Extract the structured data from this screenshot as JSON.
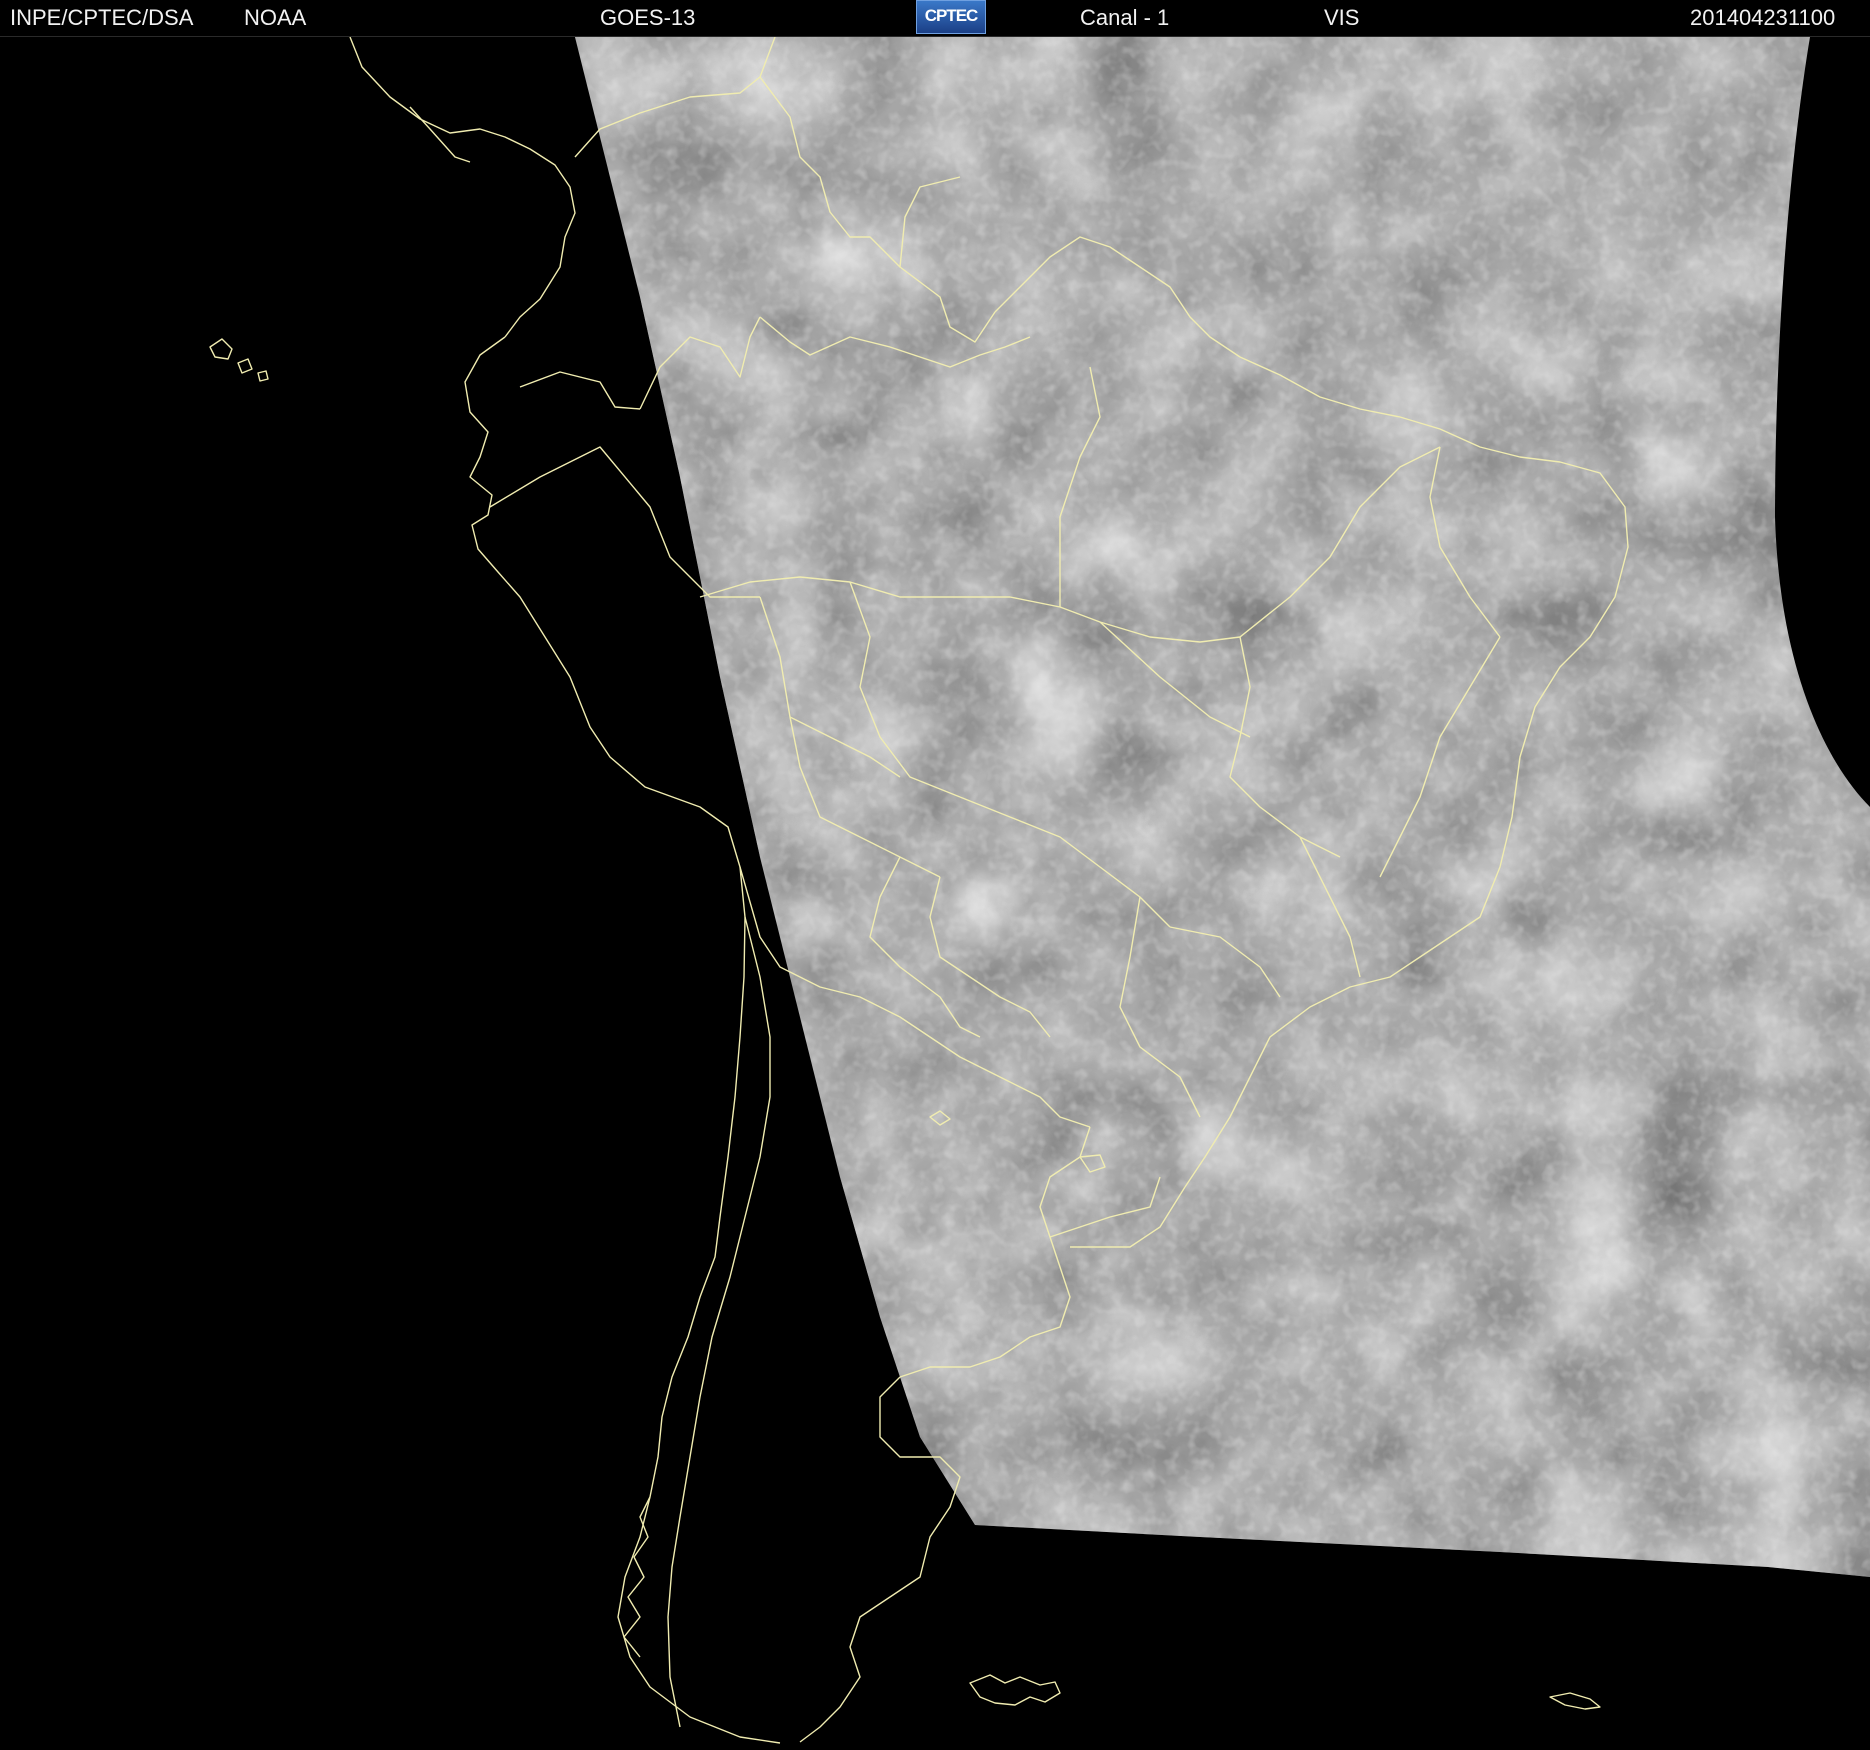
{
  "header": {
    "agency": "INPE/CPTEC/DSA",
    "source": "NOAA",
    "satellite": "GOES-13",
    "logo_text": "CPTEC",
    "channel": "Canal - 1",
    "band": "VIS",
    "timestamp": "201404231100"
  },
  "colors": {
    "background": "#000000",
    "border_lines": "#f0ecb0",
    "cloud_light": "#e6e6e6",
    "scene_gray": "#4a4a4a",
    "header_text": "#f2f2f2"
  },
  "icons": {
    "logo": "cptec-logo-icon"
  }
}
